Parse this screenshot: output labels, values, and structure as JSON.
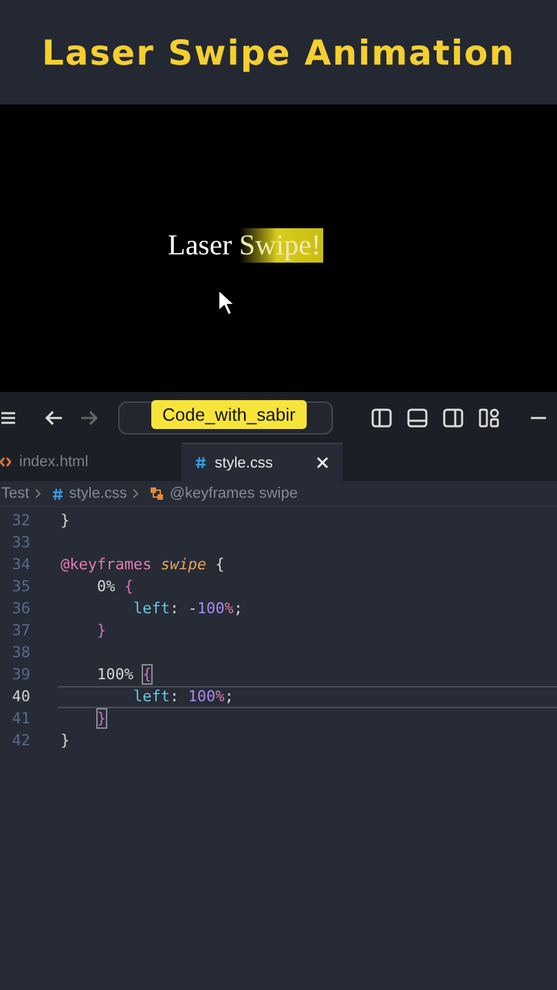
{
  "header": {
    "title": "Laser Swipe Animation"
  },
  "preview": {
    "text_plain": "Laser ",
    "text_swiped": "Swipe!"
  },
  "toolbar": {
    "forward_disabled": true,
    "tooltip": "Code_with_sabir"
  },
  "tabs": [
    {
      "label": "index.html",
      "kind": "html",
      "selected": false
    },
    {
      "label": "style.css",
      "kind": "css",
      "selected": true
    }
  ],
  "breadcrumb": [
    {
      "label": "Test",
      "kind": "folder"
    },
    {
      "label": "style.css",
      "kind": "css"
    },
    {
      "label": "@keyframes swipe",
      "kind": "symbol"
    }
  ],
  "code": {
    "lines": [
      {
        "number": "32",
        "active": false,
        "tokens": [
          {
            "text": "}",
            "kind": "plain"
          }
        ]
      },
      {
        "number": "33",
        "active": false
      },
      {
        "number": "34",
        "active": false,
        "tokens": [
          {
            "text": "@keyframes ",
            "kind": "keyword"
          },
          {
            "text": "swipe",
            "kind": "name"
          },
          {
            "text": " {",
            "kind": "plain"
          }
        ]
      },
      {
        "number": "35",
        "active": false,
        "tokens": [
          {
            "text": "    0% ",
            "kind": "plain"
          },
          {
            "text": "{",
            "kind": "brace"
          }
        ]
      },
      {
        "number": "36",
        "active": false,
        "tokens": [
          {
            "text": "        left",
            "kind": "prop"
          },
          {
            "text": ": -",
            "kind": "plain"
          },
          {
            "text": "100",
            "kind": "num"
          },
          {
            "text": "%",
            "kind": "unit"
          },
          {
            "text": ";",
            "kind": "plain"
          }
        ]
      },
      {
        "number": "37",
        "active": false,
        "tokens": [
          {
            "text": "    }",
            "kind": "brace"
          }
        ]
      },
      {
        "number": "38",
        "active": false
      },
      {
        "number": "39",
        "active": false,
        "tokens": [
          {
            "text": "    100% ",
            "kind": "plain"
          },
          {
            "text": "{",
            "kind": "brace-match"
          }
        ]
      },
      {
        "number": "40",
        "active": true,
        "tokens": [
          {
            "text": "        left",
            "kind": "prop"
          },
          {
            "text": ": ",
            "kind": "plain"
          },
          {
            "text": "100",
            "kind": "num"
          },
          {
            "text": "%",
            "kind": "unit"
          },
          {
            "text": ";",
            "kind": "plain"
          }
        ]
      },
      {
        "number": "41",
        "active": false,
        "tokens": [
          {
            "text": "    }",
            "kind": "brace-match"
          }
        ]
      },
      {
        "number": "42",
        "active": false,
        "tokens": [
          {
            "text": "}",
            "kind": "plain"
          }
        ]
      }
    ]
  }
}
